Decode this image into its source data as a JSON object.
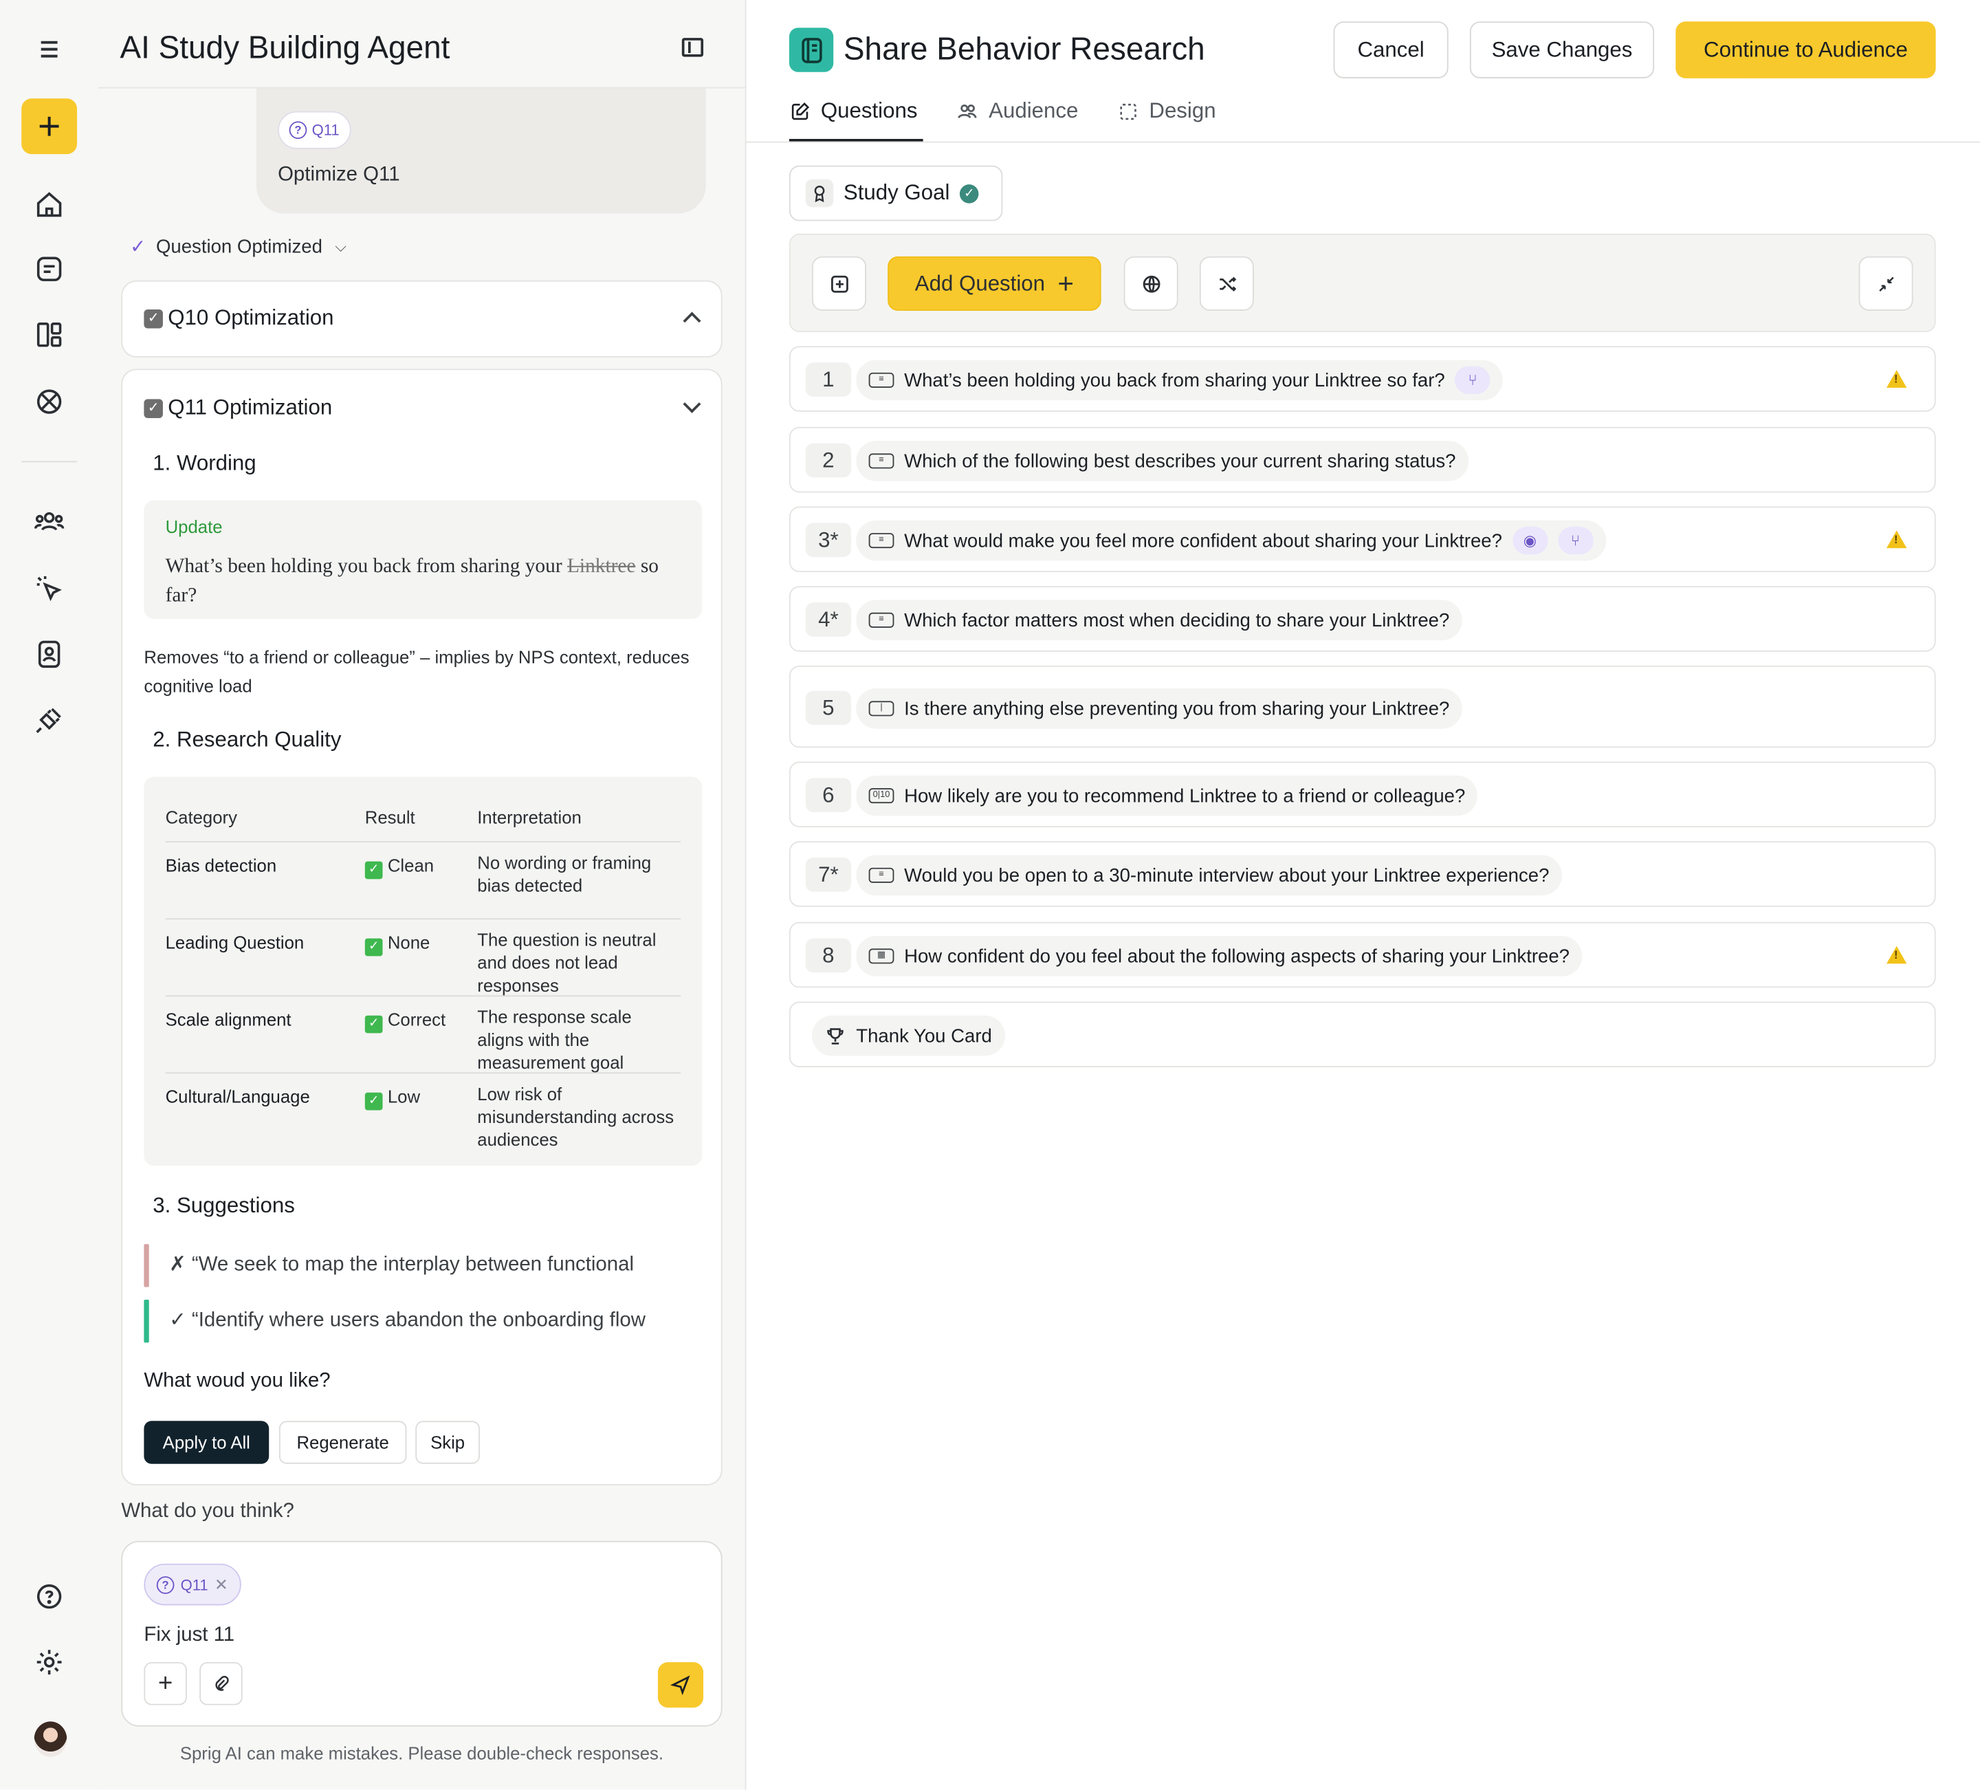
{
  "rail": {
    "icons": [
      "menu-icon",
      "plus-icon",
      "home-icon",
      "chat-icon",
      "layout-icon",
      "globe-icon",
      "users-icon",
      "cursor-click-icon",
      "contacts-icon",
      "plug-icon",
      "help-icon",
      "settings-icon"
    ]
  },
  "chat": {
    "title": "AI Study Building Agent",
    "bubble": {
      "chip": "Q11",
      "text": "Optimize Q11"
    },
    "status": "Question Optimized",
    "q10_title": "Q10 Optimization",
    "q11_title": "Q11 Optimization",
    "wording": {
      "heading": "1. Wording",
      "update_label": "Update",
      "text_before": "What’s been holding you back from sharing your",
      "struck": "Linktree",
      "text_after": "so far?",
      "note": "Removes “to a friend or colleague” – implies by NPS context, reduces cognitive load"
    },
    "quality": {
      "heading": "2. Research Quality",
      "columns": [
        "Category",
        "Result",
        "Interpretation"
      ],
      "rows": [
        {
          "category": "Bias detection",
          "result": "Clean",
          "interpretation": "No wording or framing bias detected"
        },
        {
          "category": "Leading Question",
          "result": "None",
          "interpretation": "The question is neutral and does not lead responses"
        },
        {
          "category": "Scale alignment",
          "result": "Correct",
          "interpretation": "The response scale aligns with the measurement goal"
        },
        {
          "category": "Cultural/Language",
          "result": "Low",
          "interpretation": "Low risk of misunderstanding across audiences"
        }
      ]
    },
    "suggestions": {
      "heading": "3. Suggestions",
      "bad": "✗ “We seek to map the interplay between functional",
      "good": "✓ “Identify where users abandon the onboarding flow"
    },
    "ask": "What woud you like?",
    "actions": {
      "apply": "Apply to All",
      "regenerate": "Regenerate",
      "skip": "Skip"
    },
    "think": "What do you think?",
    "composer": {
      "chip": "Q11",
      "text": "Fix just 11"
    },
    "disclaimer": "Sprig AI  can make mistakes. Please double-check responses."
  },
  "main": {
    "title": "Share Behavior Research",
    "buttons": {
      "cancel": "Cancel",
      "save": "Save Changes",
      "continue": "Continue to Audience"
    },
    "tabs": [
      "Questions",
      "Audience",
      "Design"
    ],
    "study_goal": "Study Goal",
    "add_question": "Add Question",
    "questions": [
      {
        "num": "1",
        "text": "What’s been holding you back from sharing your Linktree so far?",
        "type_icon": "list-icon",
        "tags": [
          "branch-icon"
        ],
        "warning": true
      },
      {
        "num": "2",
        "text": "Which of the following best describes your current sharing status?",
        "type_icon": "list-icon",
        "tags": [],
        "warning": false
      },
      {
        "num": "3*",
        "text": "What would make you feel more confident about sharing your Linktree?",
        "type_icon": "list-icon",
        "tags": [
          "eye-icon",
          "branch-icon"
        ],
        "warning": true
      },
      {
        "num": "4*",
        "text": "Which factor matters most when deciding to share your Linktree?",
        "type_icon": "list-icon",
        "tags": [],
        "warning": false
      },
      {
        "num": "5",
        "text": "Is there anything else preventing you from sharing your Linktree?",
        "type_icon": "text-input-icon",
        "tags": [],
        "warning": false
      },
      {
        "num": "6",
        "text": "How likely are you to recommend Linktree to a friend or colleague?",
        "type_icon": "nps-icon",
        "tags": [],
        "warning": false
      },
      {
        "num": "7*",
        "text": "Would you be open to a 30-minute interview about your Linktree experience?",
        "type_icon": "list-icon",
        "tags": [],
        "warning": false
      },
      {
        "num": "8",
        "text": "How confident do you feel about the following aspects of sharing your Linktree?",
        "type_icon": "matrix-icon",
        "tags": [],
        "warning": true
      }
    ],
    "thank_you": "Thank You Card"
  },
  "colors": {
    "accent": "#f8c92c",
    "brand_teal": "#2fb9a4",
    "purple": "#6b54c6",
    "warning": "#f2c21a"
  }
}
